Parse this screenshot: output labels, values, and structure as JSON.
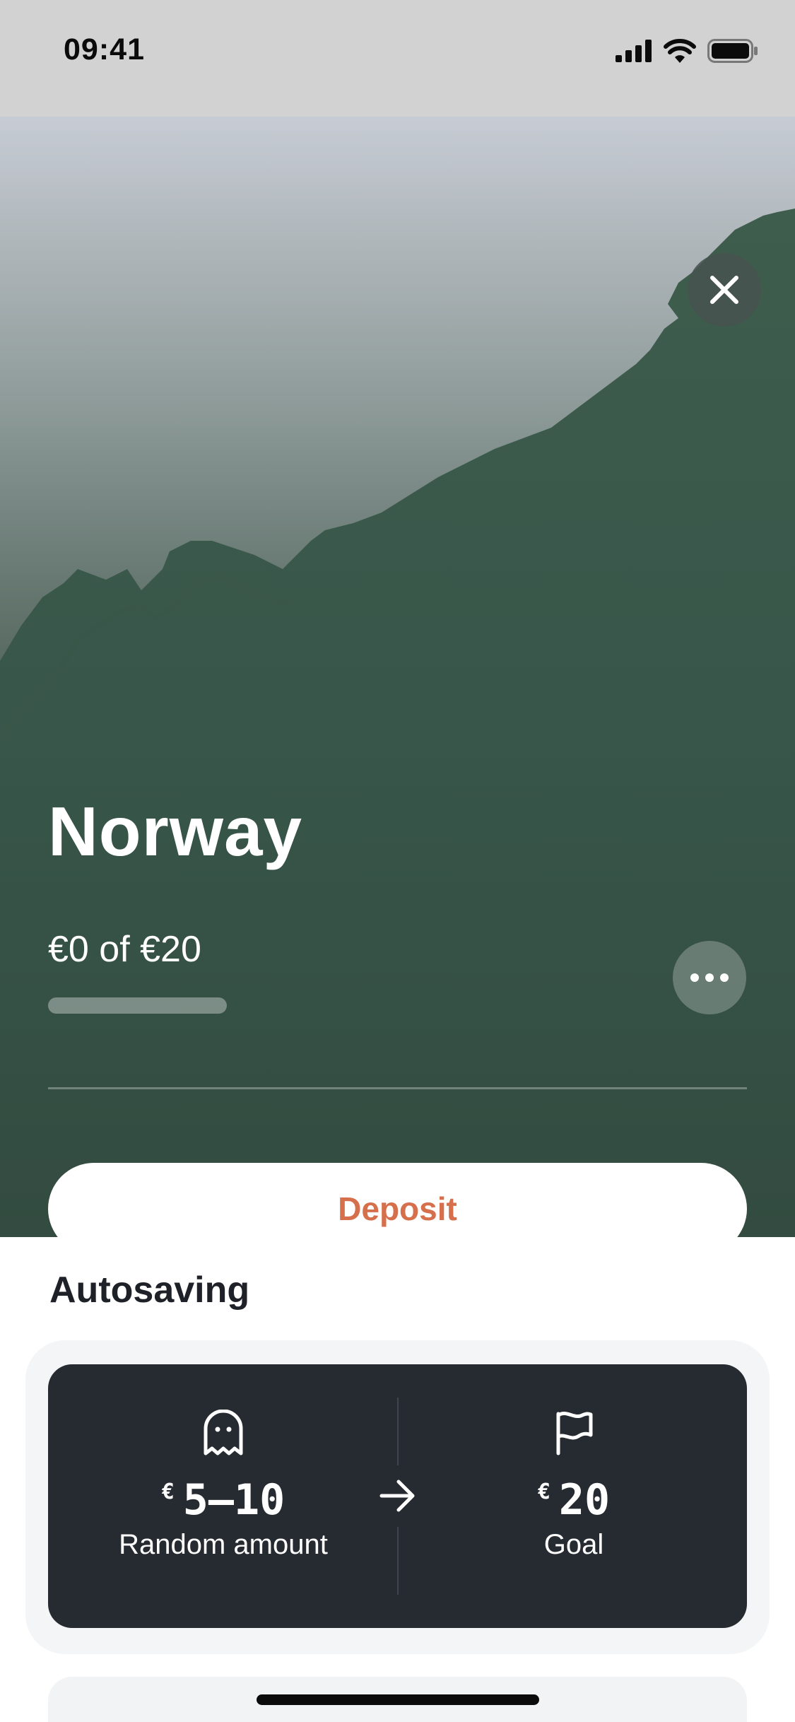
{
  "status_bar": {
    "time": "09:41",
    "icons": [
      "cellular-signal-icon",
      "wifi-icon",
      "battery-icon"
    ]
  },
  "hero": {
    "title": "Norway",
    "progress_text": "€0 of €20",
    "progress_fraction": 0,
    "close_icon": "close-icon",
    "more_icon": "more-horizontal-icon",
    "deposit_label": "Deposit",
    "accent_color": "#d6704c",
    "hero_color": "#334b40"
  },
  "autosaving": {
    "title": "Autosaving",
    "card": {
      "left": {
        "icon": "ghost-icon",
        "currency": "€",
        "value": "5–10",
        "caption": "Random amount"
      },
      "arrow_icon": "arrow-right-icon",
      "right": {
        "icon": "flag-icon",
        "currency": "€",
        "value": "20",
        "caption": "Goal"
      },
      "background": "#262a31"
    }
  }
}
